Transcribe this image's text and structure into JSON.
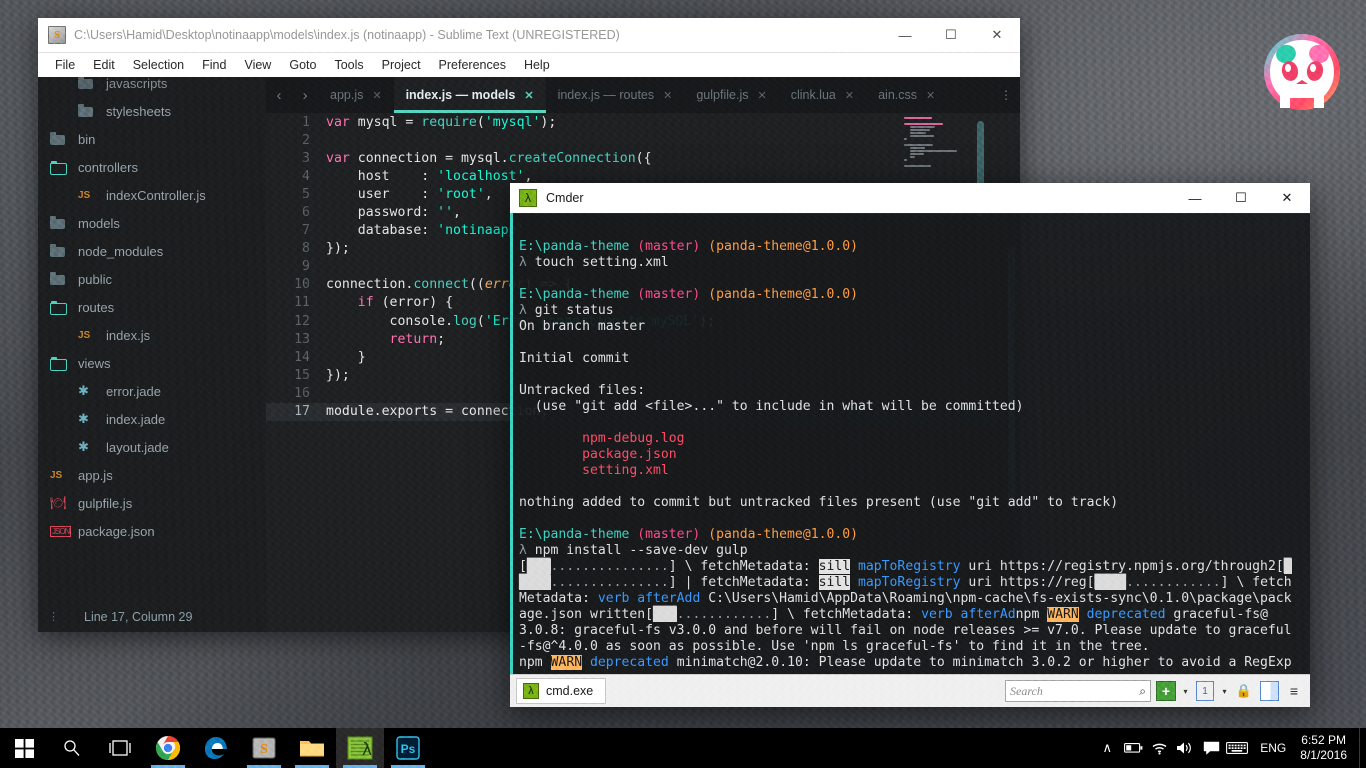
{
  "desktop": {
    "logo_name": "panda-theme-logo"
  },
  "sublime": {
    "title": "C:\\Users\\Hamid\\Desktop\\notinaapp\\models\\index.js (notinaapp) - Sublime Text (UNREGISTERED)",
    "app_icon": "sublime-text-icon",
    "window_buttons": {
      "minimize": "—",
      "maximize": "☐",
      "close": "✕"
    },
    "menu": [
      "File",
      "Edit",
      "Selection",
      "Find",
      "View",
      "Goto",
      "Tools",
      "Project",
      "Preferences",
      "Help"
    ],
    "sidebar": {
      "items": [
        {
          "label": "javascripts",
          "type": "folder",
          "indent": 2,
          "clipped": true
        },
        {
          "label": "stylesheets",
          "type": "folder",
          "indent": 2
        },
        {
          "label": "bin",
          "type": "folder",
          "indent": 1
        },
        {
          "label": "controllers",
          "type": "folder-open",
          "indent": 1
        },
        {
          "label": "indexController.js",
          "type": "js",
          "indent": 2
        },
        {
          "label": "models",
          "type": "folder",
          "indent": 1
        },
        {
          "label": "node_modules",
          "type": "folder",
          "indent": 1
        },
        {
          "label": "public",
          "type": "folder",
          "indent": 1
        },
        {
          "label": "routes",
          "type": "folder-open",
          "indent": 1
        },
        {
          "label": "index.js",
          "type": "js",
          "indent": 2
        },
        {
          "label": "views",
          "type": "folder-open",
          "indent": 1
        },
        {
          "label": "error.jade",
          "type": "jade",
          "indent": 2
        },
        {
          "label": "index.jade",
          "type": "jade",
          "indent": 2
        },
        {
          "label": "layout.jade",
          "type": "jade",
          "indent": 2
        },
        {
          "label": "app.js",
          "type": "js",
          "indent": 1
        },
        {
          "label": "gulpfile.js",
          "type": "gulp",
          "indent": 1
        },
        {
          "label": "package.json",
          "type": "pkg",
          "indent": 1
        }
      ]
    },
    "status_bar": {
      "text": "Line 17, Column 29"
    },
    "nav": {
      "prev": "‹",
      "next": "›",
      "more": "⋮"
    },
    "tabs": [
      {
        "label": "app.js",
        "active": false
      },
      {
        "label": "index.js — models",
        "active": true
      },
      {
        "label": "index.js — routes",
        "active": false
      },
      {
        "label": "gulpfile.js",
        "active": false
      },
      {
        "label": "clink.lua",
        "active": false
      },
      {
        "label": "ain.css",
        "active": false
      }
    ],
    "code": {
      "current_line": 17,
      "lines": [
        {
          "n": 1,
          "tokens": [
            [
              "k-kw",
              "var"
            ],
            [
              "k-plain",
              " mysql = "
            ],
            [
              "k-fn",
              "require"
            ],
            [
              "k-plain",
              "("
            ],
            [
              "k-str",
              "'mysql'"
            ],
            [
              "k-plain",
              ");"
            ]
          ]
        },
        {
          "n": 2,
          "tokens": []
        },
        {
          "n": 3,
          "tokens": [
            [
              "k-kw",
              "var"
            ],
            [
              "k-plain",
              " connection = mysql."
            ],
            [
              "k-fn",
              "createConnection"
            ],
            [
              "k-plain",
              "({"
            ]
          ]
        },
        {
          "n": 4,
          "tokens": [
            [
              "k-plain",
              "    host    : "
            ],
            [
              "k-str",
              "'localhost'"
            ],
            [
              "k-plain",
              ","
            ]
          ]
        },
        {
          "n": 5,
          "tokens": [
            [
              "k-plain",
              "    user    : "
            ],
            [
              "k-str",
              "'root'"
            ],
            [
              "k-plain",
              ","
            ]
          ]
        },
        {
          "n": 6,
          "tokens": [
            [
              "k-plain",
              "    password: "
            ],
            [
              "k-str",
              "''"
            ],
            [
              "k-plain",
              ","
            ]
          ]
        },
        {
          "n": 7,
          "tokens": [
            [
              "k-plain",
              "    database: "
            ],
            [
              "k-str",
              "'notinaapp'"
            ]
          ]
        },
        {
          "n": 8,
          "tokens": [
            [
              "k-plain",
              "});"
            ]
          ]
        },
        {
          "n": 9,
          "tokens": []
        },
        {
          "n": 10,
          "tokens": [
            [
              "k-plain",
              "connection."
            ],
            [
              "k-fn",
              "connect"
            ],
            [
              "k-plain",
              "(("
            ],
            [
              "k-param",
              "error"
            ],
            [
              "k-plain",
              ") => {"
            ]
          ]
        },
        {
          "n": 11,
          "tokens": [
            [
              "k-plain",
              "    "
            ],
            [
              "k-kw",
              "if"
            ],
            [
              "k-plain",
              " (error) {"
            ]
          ]
        },
        {
          "n": 12,
          "tokens": [
            [
              "k-plain",
              "        console."
            ],
            [
              "k-fn",
              "log"
            ],
            [
              "k-plain",
              "("
            ],
            [
              "k-str",
              "'Error connecting to mySQL'"
            ],
            [
              "k-plain",
              ");"
            ]
          ]
        },
        {
          "n": 13,
          "tokens": [
            [
              "k-plain",
              "        "
            ],
            [
              "k-kw",
              "return"
            ],
            [
              "k-plain",
              ";"
            ]
          ]
        },
        {
          "n": 14,
          "tokens": [
            [
              "k-plain",
              "    }"
            ]
          ]
        },
        {
          "n": 15,
          "tokens": [
            [
              "k-plain",
              "});"
            ]
          ]
        },
        {
          "n": 16,
          "tokens": []
        },
        {
          "n": 17,
          "tokens": [
            [
              "k-plain",
              "module.exports = connection;"
            ]
          ]
        }
      ]
    }
  },
  "cmder": {
    "title": "Cmder",
    "app_icon": "lambda-icon",
    "window_buttons": {
      "minimize": "—",
      "maximize": "☐",
      "close": "✕"
    },
    "console_lines": [
      {
        "tokens": []
      },
      {
        "tokens": [
          [
            "t-path",
            "E:\\panda-theme "
          ],
          [
            "t-branch",
            "(master)"
          ],
          [
            "t-plain",
            " "
          ],
          [
            "t-pkg",
            "(panda-theme@1.0.0)"
          ]
        ]
      },
      {
        "tokens": [
          [
            "t-lambda",
            "λ"
          ],
          [
            "t-plain",
            " touch setting.xml"
          ]
        ]
      },
      {
        "tokens": []
      },
      {
        "tokens": [
          [
            "t-path",
            "E:\\panda-theme "
          ],
          [
            "t-branch",
            "(master)"
          ],
          [
            "t-plain",
            " "
          ],
          [
            "t-pkg",
            "(panda-theme@1.0.0)"
          ]
        ]
      },
      {
        "tokens": [
          [
            "t-lambda",
            "λ"
          ],
          [
            "t-plain",
            " git status"
          ]
        ]
      },
      {
        "tokens": [
          [
            "t-plain",
            "On branch master"
          ]
        ]
      },
      {
        "tokens": []
      },
      {
        "tokens": [
          [
            "t-plain",
            "Initial commit"
          ]
        ]
      },
      {
        "tokens": []
      },
      {
        "tokens": [
          [
            "t-plain",
            "Untracked files:"
          ]
        ]
      },
      {
        "tokens": [
          [
            "t-plain",
            "  (use \"git add <file>...\" to include in what will be committed)"
          ]
        ]
      },
      {
        "tokens": []
      },
      {
        "tokens": [
          [
            "t-red",
            "        npm-debug.log"
          ]
        ]
      },
      {
        "tokens": [
          [
            "t-red",
            "        package.json"
          ]
        ]
      },
      {
        "tokens": [
          [
            "t-red",
            "        setting.xml"
          ]
        ]
      },
      {
        "tokens": []
      },
      {
        "tokens": [
          [
            "t-plain",
            "nothing added to commit but untracked files present (use \"git add\" to track)"
          ]
        ]
      },
      {
        "tokens": []
      },
      {
        "tokens": [
          [
            "t-path",
            "E:\\panda-theme "
          ],
          [
            "t-branch",
            "(master)"
          ],
          [
            "t-plain",
            " "
          ],
          [
            "t-pkg",
            "(panda-theme@1.0.0)"
          ]
        ]
      },
      {
        "tokens": [
          [
            "t-lambda",
            "λ"
          ],
          [
            "t-plain",
            " npm install --save-dev gulp"
          ]
        ]
      },
      {
        "tokens": [
          [
            "t-plain",
            "["
          ],
          [
            "t-bar",
            "███"
          ],
          [
            "t-dots",
            "..............."
          ],
          [
            "t-plain",
            "] \\ fetchMetadata: "
          ],
          [
            "t-sill",
            "sill"
          ],
          [
            "t-plain",
            " "
          ],
          [
            "t-blue",
            "mapToRegistry"
          ],
          [
            "t-plain",
            " uri https://registry.npmjs.org/through2["
          ],
          [
            "t-bar",
            "█"
          ]
        ]
      },
      {
        "tokens": [
          [
            "t-bar",
            "████"
          ],
          [
            "t-dots",
            "..............."
          ],
          [
            "t-plain",
            "] | fetchMetadata: "
          ],
          [
            "t-sill",
            "sill"
          ],
          [
            "t-plain",
            " "
          ],
          [
            "t-blue",
            "mapToRegistry"
          ],
          [
            "t-plain",
            " uri https://reg["
          ],
          [
            "t-bar",
            "████"
          ],
          [
            "t-dots",
            "............"
          ],
          [
            "t-plain",
            "] \\ fetch"
          ]
        ]
      },
      {
        "tokens": [
          [
            "t-plain",
            "Metadata: "
          ],
          [
            "t-blue",
            "verb afterAdd"
          ],
          [
            "t-plain",
            " C:\\Users\\Hamid\\AppData\\Roaming\\npm-cache\\fs-exists-sync\\0.1.0\\package\\pack"
          ]
        ]
      },
      {
        "tokens": [
          [
            "t-plain",
            "age.json written["
          ],
          [
            "t-bar",
            "███"
          ],
          [
            "t-dots",
            "............"
          ],
          [
            "t-plain",
            "] \\ fetchMetadata: "
          ],
          [
            "t-blue",
            "verb afterAd"
          ],
          [
            "t-plain",
            "npm "
          ],
          [
            "t-warn",
            "WARN"
          ],
          [
            "t-plain",
            " "
          ],
          [
            "t-blue",
            "deprecated"
          ],
          [
            "t-plain",
            " graceful-fs@"
          ]
        ]
      },
      {
        "tokens": [
          [
            "t-plain",
            "3.0.8: graceful-fs v3.0.0 and before will fail on node releases >= v7.0. Please update to graceful"
          ]
        ]
      },
      {
        "tokens": [
          [
            "t-plain",
            "-fs@^4.0.0 as soon as possible. Use 'npm ls graceful-fs' to find it in the tree."
          ]
        ]
      },
      {
        "tokens": [
          [
            "t-plain",
            "npm "
          ],
          [
            "t-warn",
            "WARN"
          ],
          [
            "t-plain",
            " "
          ],
          [
            "t-blue",
            "deprecated"
          ],
          [
            "t-plain",
            " minimatch@2.0.10: Please update to minimatch 3.0.2 or higher to avoid a RegExp"
          ]
        ]
      }
    ],
    "status_bar": {
      "tab_label": "cmd.exe",
      "tab_icon": "lambda-icon",
      "search_placeholder": "Search",
      "search_value": "",
      "buttons": [
        {
          "name": "new-console-button",
          "glyph": "+"
        },
        {
          "name": "new-console-dropdown",
          "glyph": "▾"
        },
        {
          "name": "active-console-button",
          "glyph": "1"
        },
        {
          "name": "active-console-dropdown",
          "glyph": "▾"
        },
        {
          "name": "admin-lock-icon",
          "glyph": "🔒"
        },
        {
          "name": "toggle-panel-button",
          "glyph": ""
        },
        {
          "name": "menu-button",
          "glyph": "≡"
        }
      ]
    }
  },
  "taskbar": {
    "start": "start-button",
    "system_icons": [
      {
        "name": "search-icon",
        "glyph": "⚲"
      },
      {
        "name": "task-view-icon",
        "glyph": "▭"
      }
    ],
    "apps": [
      {
        "name": "chrome-icon",
        "label": "Google Chrome",
        "running": true,
        "active": false
      },
      {
        "name": "edge-icon",
        "label": "Microsoft Edge",
        "running": false,
        "active": false
      },
      {
        "name": "sublime-text-icon",
        "label": "Sublime Text",
        "running": true,
        "active": false
      },
      {
        "name": "file-explorer-icon",
        "label": "File Explorer",
        "running": true,
        "active": false
      },
      {
        "name": "cmder-icon",
        "label": "Cmder",
        "running": true,
        "active": true
      },
      {
        "name": "photoshop-icon",
        "label": "Adobe Photoshop",
        "running": true,
        "active": false
      }
    ],
    "tray": {
      "show_hidden": "∧",
      "icons": [
        {
          "name": "battery-icon"
        },
        {
          "name": "wifi-icon"
        },
        {
          "name": "volume-icon"
        },
        {
          "name": "action-center-icon"
        },
        {
          "name": "keyboard-icon"
        }
      ],
      "language": "ENG",
      "time": "6:52 PM",
      "date": "8/1/2016"
    }
  }
}
